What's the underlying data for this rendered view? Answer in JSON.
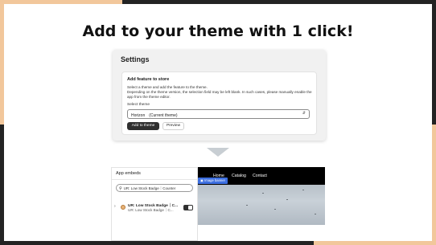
{
  "headline": "Add to your theme with 1 click!",
  "colors": {
    "accent_peach": "#f2c79b",
    "dark_bar": "#232323",
    "button_dark": "#303030",
    "tag_blue": "#3d6fe0"
  },
  "settings": {
    "title": "Settings",
    "card": {
      "title": "Add feature to store",
      "description": "Select a theme and add the feature to the theme.\nDepending on the theme version, the selection field may be left blank. In such cases, please manually enable the app from the theme editor.",
      "theme_label": "Select theme",
      "theme_value": "Horizon　(Current theme)",
      "add_button": "Add to theme",
      "preview_button": "Preview"
    }
  },
  "arrow_icon": "down-triangle-icon",
  "embeds": {
    "title": "App embeds",
    "search_value": "UR: Low Stock Badge｜Counter",
    "row": {
      "name": "UR: Low Stock Badge｜C...",
      "sub": "UR: Low Stock Badge｜C...",
      "enabled": true
    }
  },
  "storefront": {
    "nav": [
      "Home",
      "Catalog",
      "Contact"
    ],
    "banner_tag": "Image banner"
  }
}
